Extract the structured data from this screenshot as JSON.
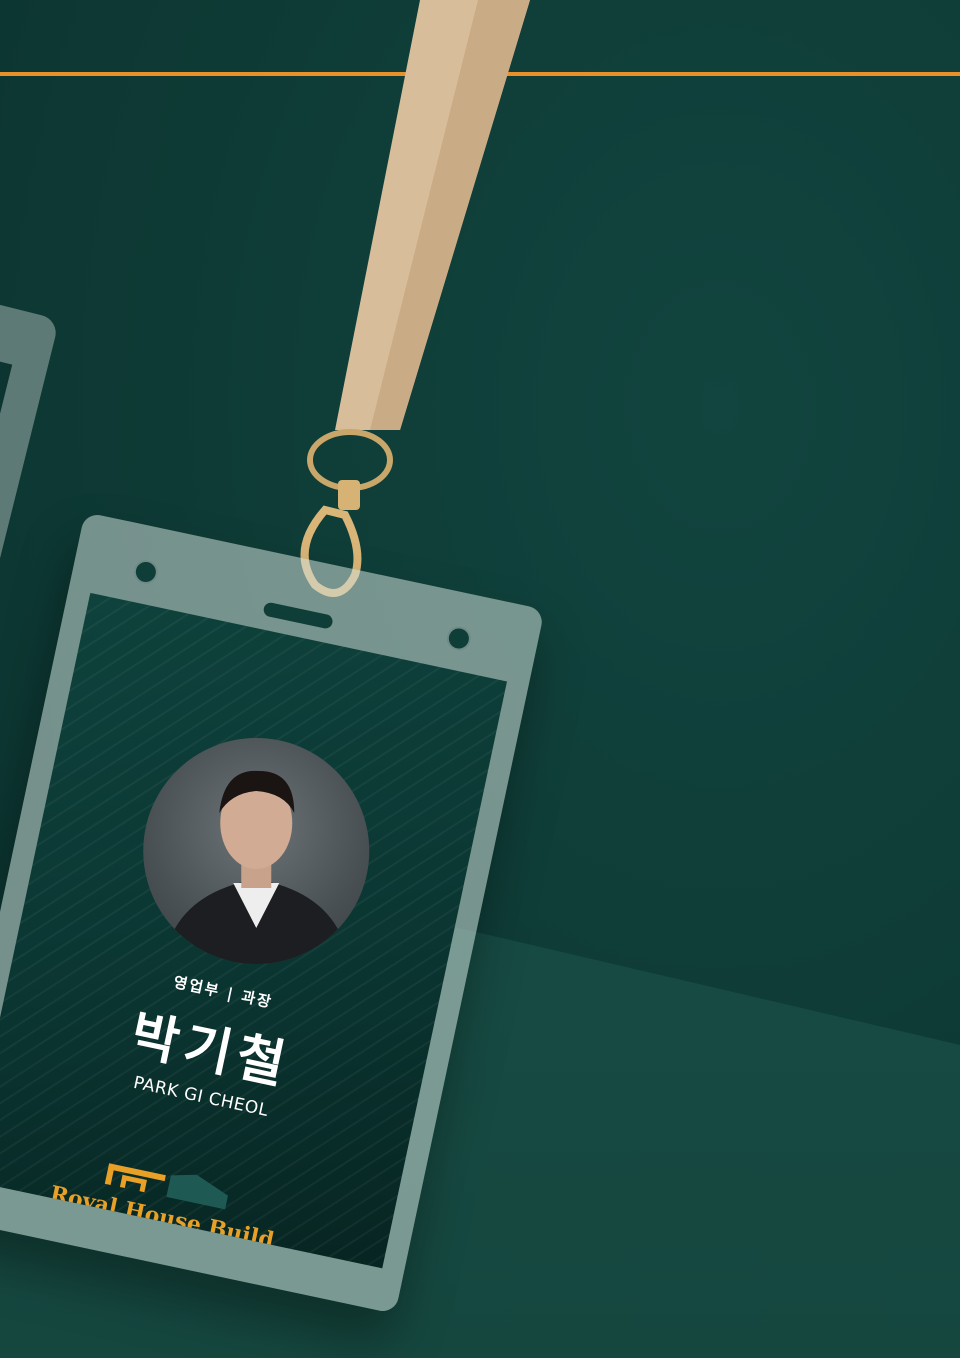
{
  "badge": {
    "department": "영업부 | 과장",
    "name_korean": "박기철",
    "name_english": "PARK GI CHEOL",
    "company": "Royal House Build"
  },
  "colors": {
    "background": "#0f3d38",
    "accent_line": "#e8902a",
    "lanyard": "#d8bd9a",
    "logo": "#e8a027"
  }
}
